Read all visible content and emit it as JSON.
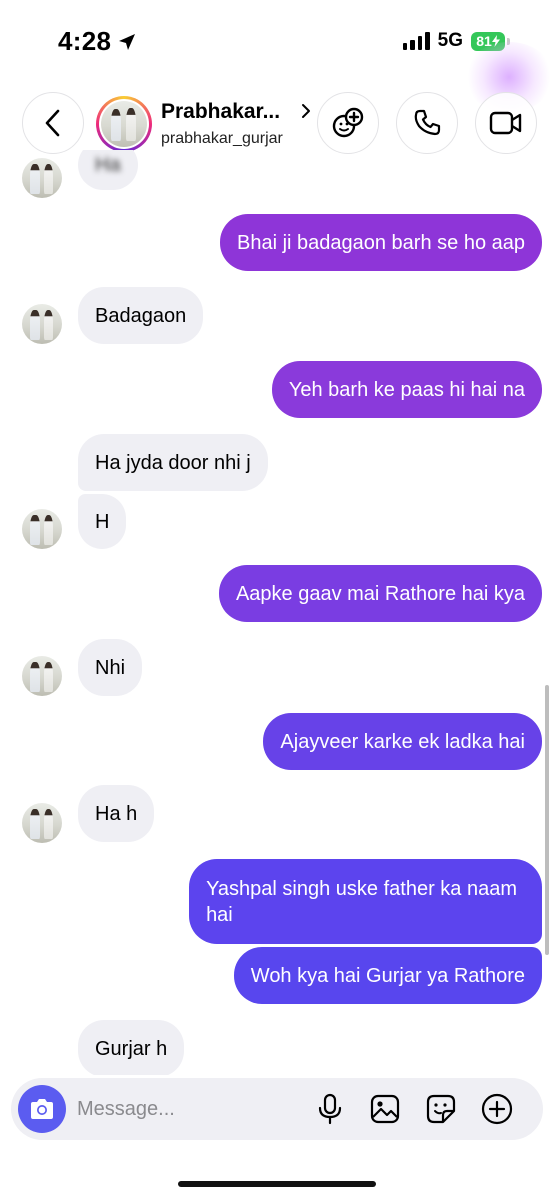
{
  "status_bar": {
    "time": "4:28",
    "network": "5G",
    "battery": "81",
    "battery_color": "#34c759"
  },
  "header": {
    "name": "Prabhakar...",
    "username": "prabhakar_gurjar",
    "icons": [
      "chevron-left-icon",
      "chevron-right-icon",
      "add-people-icon",
      "phone-icon",
      "video-camera-icon"
    ]
  },
  "colors": {
    "incoming_bubble": "#efeff4",
    "outgoing_purple": "#8e35d8",
    "outgoing_indigo": "#5b44ee",
    "camera_button": "#5b5cf0"
  },
  "messages": [
    {
      "direction": "in",
      "text": "Ha",
      "blurred": true
    },
    {
      "direction": "out",
      "text": "Bhai ji badagaon barh se ho aap"
    },
    {
      "direction": "in",
      "text": "Badagaon"
    },
    {
      "direction": "out",
      "text": "Yeh barh ke paas hi hai na"
    },
    {
      "direction": "in",
      "text": "Ha jyda door nhi j"
    },
    {
      "direction": "in",
      "text": "H"
    },
    {
      "direction": "out",
      "text": "Aapke gaav mai Rathore hai kya"
    },
    {
      "direction": "in",
      "text": "Nhi"
    },
    {
      "direction": "out",
      "text": "Ajayveer karke ek ladka hai"
    },
    {
      "direction": "in",
      "text": "Ha h"
    },
    {
      "direction": "out",
      "lines": [
        "Yashpal singh uske father ka naam",
        "hai"
      ]
    },
    {
      "direction": "out",
      "text": "Woh kya hai Gurjar ya Rathore"
    },
    {
      "direction": "in",
      "text": "Gurjar h"
    }
  ],
  "composer": {
    "placeholder": "Message...",
    "icons": [
      "camera-icon",
      "microphone-icon",
      "gallery-icon",
      "sticker-icon",
      "add-icon"
    ]
  }
}
